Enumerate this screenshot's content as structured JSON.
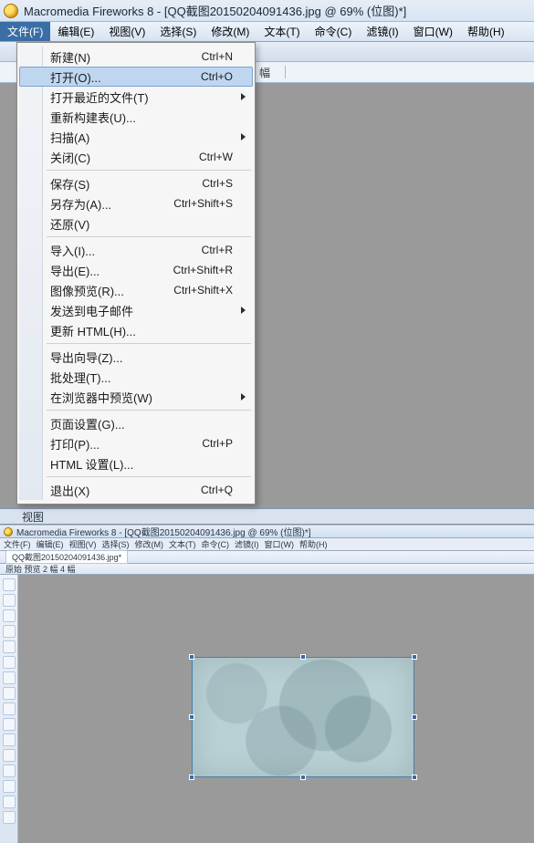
{
  "app": {
    "title": "Macromedia Fireworks 8 - [QQ截图20150204091436.jpg @  69% (位图)*]"
  },
  "menubar": {
    "items": [
      {
        "label": "文件(F)",
        "key": "F"
      },
      {
        "label": "编辑(E)",
        "key": "E"
      },
      {
        "label": "视图(V)",
        "key": "V"
      },
      {
        "label": "选择(S)",
        "key": "S"
      },
      {
        "label": "修改(M)",
        "key": "M"
      },
      {
        "label": "文本(T)",
        "key": "T"
      },
      {
        "label": "命令(C)",
        "key": "C"
      },
      {
        "label": "滤镜(I)",
        "key": "I"
      },
      {
        "label": "窗口(W)",
        "key": "W"
      },
      {
        "label": "帮助(H)",
        "key": "H"
      }
    ]
  },
  "file_menu": {
    "groups": [
      [
        {
          "label": "新建(N)",
          "shortcut": "Ctrl+N"
        },
        {
          "label": "打开(O)...",
          "shortcut": "Ctrl+O",
          "highlight": true
        },
        {
          "label": "打开最近的文件(T)",
          "submenu": true
        },
        {
          "label": "重新构建表(U)..."
        },
        {
          "label": "扫描(A)",
          "submenu": true
        },
        {
          "label": "关闭(C)",
          "shortcut": "Ctrl+W"
        }
      ],
      [
        {
          "label": "保存(S)",
          "shortcut": "Ctrl+S"
        },
        {
          "label": "另存为(A)...",
          "shortcut": "Ctrl+Shift+S"
        },
        {
          "label": "还原(V)"
        }
      ],
      [
        {
          "label": "导入(I)...",
          "shortcut": "Ctrl+R"
        },
        {
          "label": "导出(E)...",
          "shortcut": "Ctrl+Shift+R"
        },
        {
          "label": "图像预览(R)...",
          "shortcut": "Ctrl+Shift+X"
        },
        {
          "label": "发送到电子邮件",
          "submenu": true
        },
        {
          "label": "更新 HTML(H)..."
        }
      ],
      [
        {
          "label": "导出向导(Z)..."
        },
        {
          "label": "批处理(T)..."
        },
        {
          "label": "在浏览器中预览(W)",
          "submenu": true
        }
      ],
      [
        {
          "label": "页面设置(G)..."
        },
        {
          "label": "打印(P)...",
          "shortcut": "Ctrl+P"
        },
        {
          "label": "HTML 设置(L)..."
        }
      ],
      [
        {
          "label": "退出(X)",
          "shortcut": "Ctrl+Q"
        }
      ]
    ]
  },
  "options_row": {
    "visible_text": "幅"
  },
  "panel": {
    "label": "视图"
  },
  "embedded": {
    "title": "Macromedia Fireworks 8 - [QQ截图20150204091436.jpg @  69% (位图)*]",
    "menubar": [
      "文件(F)",
      "编辑(E)",
      "视图(V)",
      "选择(S)",
      "修改(M)",
      "文本(T)",
      "命令(C)",
      "滤镜(I)",
      "窗口(W)",
      "帮助(H)"
    ],
    "tab": "QQ截图20150204091436.jpg*",
    "subtabs": "原始   预览   2 幅   4 幅"
  }
}
